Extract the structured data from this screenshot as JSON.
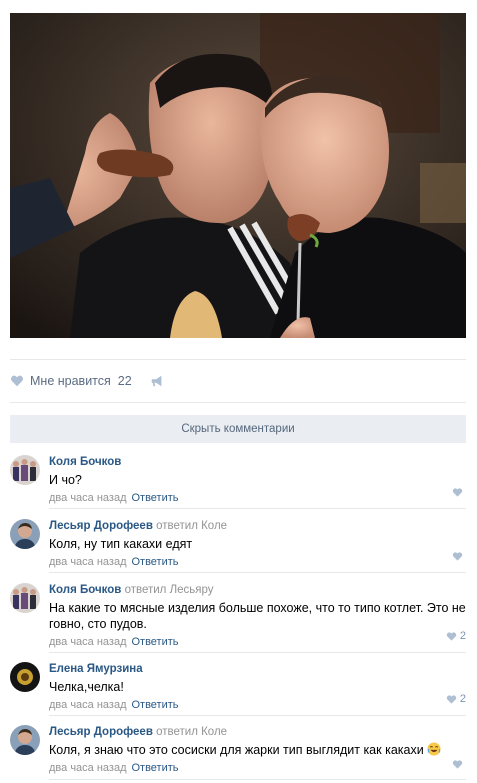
{
  "post": {
    "likes_label": "Мне нравится",
    "likes_count": "22",
    "hide_comments_label": "Скрыть комментарии"
  },
  "reply_label": "Ответить",
  "comments": [
    {
      "author": "Коля Бочков",
      "replied": "",
      "replied_to": "",
      "text": "И чо?",
      "time": "два часа назад",
      "likes": ""
    },
    {
      "author": "Лесьяр Дорофеев",
      "replied": "ответил",
      "replied_to": "Коле",
      "text": "Коля, ну тип какахи едят",
      "time": "два часа назад",
      "likes": ""
    },
    {
      "author": "Коля Бочков",
      "replied": "ответил",
      "replied_to": "Лесьяру",
      "text": "На какие то мясные изделия больше похоже, что то типо котлет. Это не говно, сто пудов.",
      "time": "два часа назад",
      "likes": "2"
    },
    {
      "author": "Елена Ямурзина",
      "replied": "",
      "replied_to": "",
      "text": "Челка,челка!",
      "time": "два часа назад",
      "likes": "2"
    },
    {
      "author": "Лесьяр Дорофеев",
      "replied": "ответил",
      "replied_to": "Коле",
      "text": "Коля, я знаю что это сосиски для жарки тип выглядит как какахи",
      "time": "два часа назад",
      "likes": ""
    }
  ],
  "colors": {
    "link": "#2a5885",
    "muted": "#939393",
    "like_icon": "#aebed3",
    "button_bg": "#eaedf1"
  },
  "icons": [
    "heart-icon",
    "megaphone-icon",
    "laughing-emoji-icon"
  ]
}
